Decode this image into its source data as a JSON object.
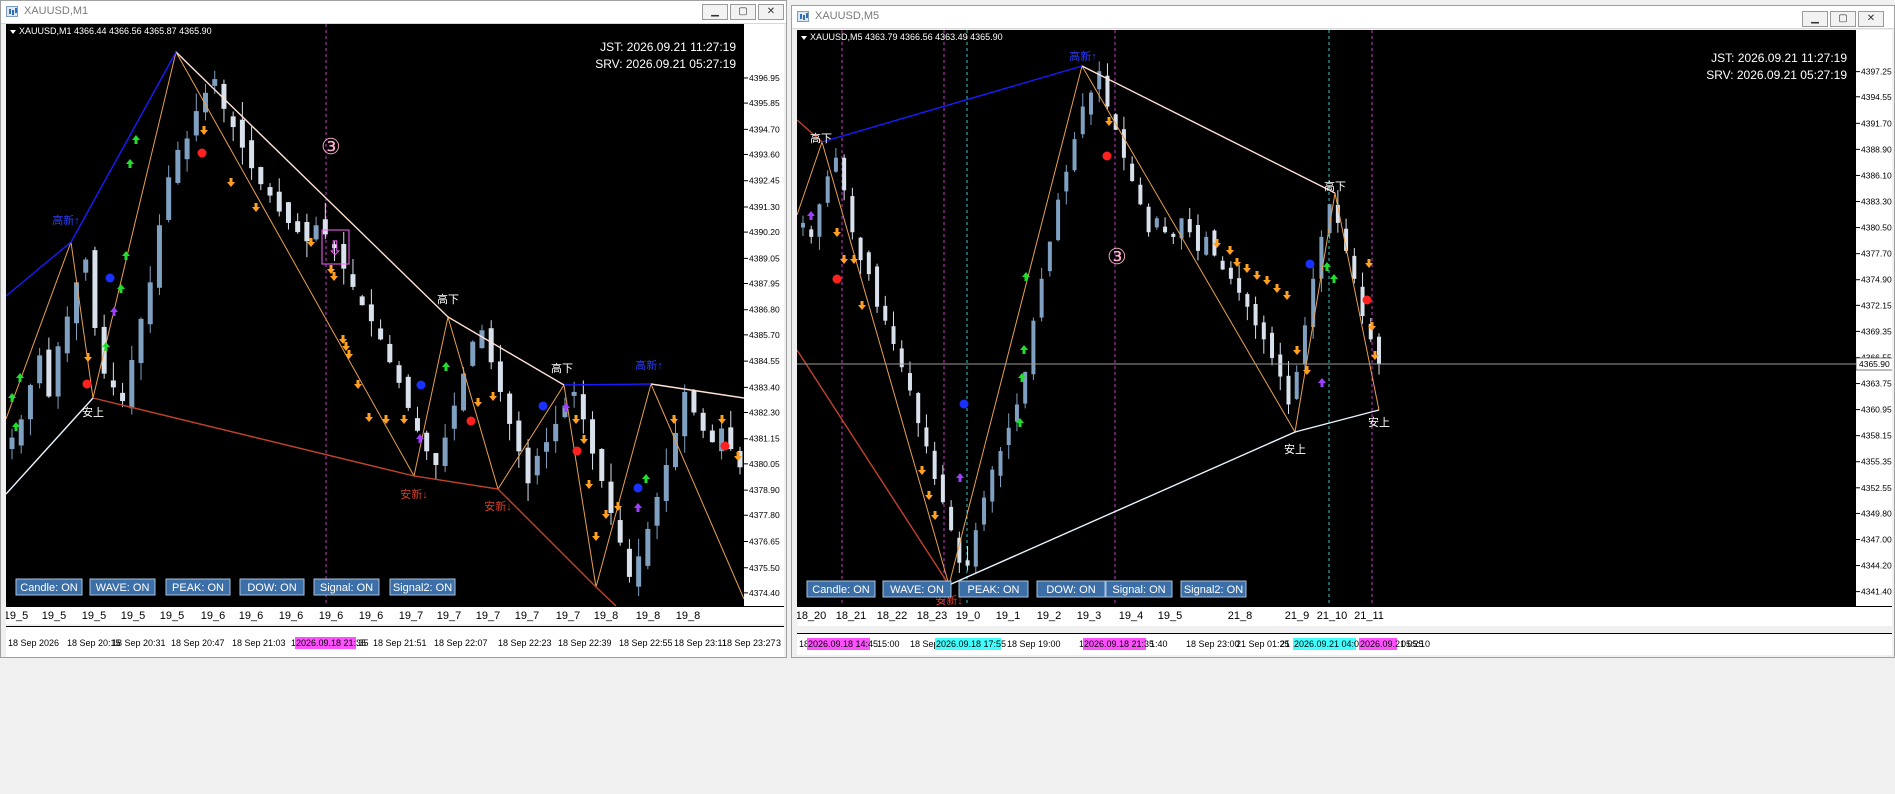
{
  "colors": {
    "bull": "#7fa0c0",
    "bear": "#d9e2ec",
    "zig": "#e8a050",
    "swing_top": "#ffe2d6",
    "swing_blue": "#1a1aff",
    "swing_red": "#c0422c",
    "swing_white": "#e8f4ff",
    "arrow_up": "#20dd30",
    "arrow_down": "#ffa020",
    "arrow_purple": "#a040ff",
    "dot_red": "#ff2020",
    "dot_blue": "#1a30ff",
    "vline_magenta": "#c040c0",
    "vline_cyan": "#40c0c0",
    "button_bg": "#3c6ea8",
    "button_text": "#ffffff",
    "label_jp": "#ffffff",
    "label_blue": "#2a3cff",
    "label_red": "#d2402a",
    "marker": "#ff60ff"
  },
  "left": {
    "window_title": "XAUUSD,M1",
    "header": "XAUUSD,M1  4366.44 4366.56 4365.87 4365.90",
    "jst": "JST: 2026.09.21 11:27:19",
    "srv": "SRV: 2026.09.21 05:27:19",
    "circled": "③",
    "last_price_label": "",
    "buttons": [
      "Candle: ON",
      "WAVE: ON",
      "PEAK: ON",
      "DOW: ON",
      "Signal: ON",
      "Signal2: ON"
    ],
    "wave_labels": [
      "19_5",
      "19_5",
      "19_5",
      "19_5",
      "19_5",
      "19_6",
      "19_6",
      "19_6",
      "19_6",
      "19_6",
      "19_7",
      "19_7",
      "19_7",
      "19_7",
      "19_7",
      "19_8",
      "19_8",
      "19_8"
    ],
    "time_labels": [
      "18 Sep 2026",
      "18 Sep 20:15",
      "18 Sep 20:31",
      "18 Sep 20:47",
      "18 Sep 21:03",
      "18 Se",
      "2026.09.18 21:35",
      ":35",
      "18 Sep 21:51",
      "18 Sep 22:07",
      "18 Sep 22:23",
      "18 Sep 22:39",
      "18 Sep 22:55",
      "18 Sep 23:11",
      "18 Sep 23:27"
    ],
    "jp_labels": [
      "高新↑",
      "安上",
      "高下",
      "安新↓",
      "安新↓",
      "高下",
      "高新↑"
    ],
    "chart_data": {
      "type": "candlestick",
      "symbol": "XAUUSD",
      "timeframe": "M1",
      "price_ticks": [
        4396.95,
        4395.85,
        4394.7,
        4393.6,
        4392.45,
        4391.3,
        4390.2,
        4389.05,
        4387.95,
        4386.8,
        4385.7,
        4384.55,
        4383.4,
        4382.3,
        4381.15,
        4380.05,
        4378.9,
        4377.8,
        4376.65,
        4375.5,
        4374.4
      ],
      "ylim": [
        4374.0,
        4398.0
      ],
      "x_axis_right_label": "3",
      "last_close": 4365.9,
      "note_close_series": "approximate closes, oldest to newest",
      "close": [
        4381.2,
        4382.0,
        4383.5,
        4384.8,
        4383.0,
        4385.2,
        4386.5,
        4388.0,
        4389.0,
        4386.0,
        4384.0,
        4383.4,
        4382.8,
        4384.6,
        4386.4,
        4388.0,
        4390.5,
        4392.6,
        4393.8,
        4394.3,
        4395.5,
        4396.3,
        4396.9,
        4395.6,
        4394.8,
        4393.9,
        4393.0,
        4392.3,
        4391.8,
        4391.1,
        4390.6,
        4390.2,
        4389.8,
        4390.5,
        4390.1,
        4389.5,
        4388.6,
        4387.8,
        4387.0,
        4386.3,
        4385.5,
        4384.5,
        4383.6,
        4382.5,
        4381.5,
        4380.6,
        4380.0,
        4381.2,
        4382.6,
        4384.0,
        4385.4,
        4385.9,
        4384.5,
        4383.2,
        4381.8,
        4380.6,
        4379.2,
        4380.4,
        4381.0,
        4381.8,
        4382.6,
        4383.2,
        4382.0,
        4380.5,
        4379.3,
        4377.9,
        4376.6,
        4375.1,
        4376.0,
        4377.2,
        4378.6,
        4380.0,
        4381.4,
        4383.2,
        4382.3,
        4381.5,
        4381.0,
        4381.6,
        4380.7,
        4379.9
      ]
    }
  },
  "right": {
    "window_title": "XAUUSD,M5",
    "header": "XAUUSD,M5  4363.79 4366.56 4363.49 4365.90",
    "jst": "JST: 2026.09.21 11:27:19",
    "srv": "SRV: 2026.09.21 05:27:19",
    "circled": "③",
    "last_price_label": "4365.90",
    "buttons": [
      "Candle: ON",
      "WAVE: ON",
      "PEAK: ON",
      "DOW: ON",
      "Signal: ON",
      "Signal2: ON"
    ],
    "wave_labels": [
      "18_20",
      "18_21",
      "18_22",
      "18_23",
      "19_0",
      "19_1",
      "19_2",
      "19_3",
      "19_4",
      "19_5",
      "21_8",
      "21_9",
      "21_10",
      "21_11"
    ],
    "time_labels": [
      "18",
      "2026.09.18 14:45",
      "15:00",
      "18 Sep 1",
      "2026.09.18 17:55",
      "18 Sep 19:00",
      "18",
      "2026.09.18 21:35",
      "1:40",
      "18 Sep 23:00",
      "21 Sep 01:25",
      "21 Se",
      "2026.09.21 04:05",
      "2026.09.21 05:10",
      "05:25"
    ],
    "jp_labels": [
      "高下",
      "高新↑",
      "安新↓",
      "高下",
      "安上",
      "安上"
    ],
    "chart_data": {
      "type": "candlestick",
      "symbol": "XAUUSD",
      "timeframe": "M5",
      "price_ticks": [
        4397.25,
        4394.55,
        4391.7,
        4388.9,
        4386.1,
        4383.3,
        4380.5,
        4377.7,
        4374.9,
        4372.15,
        4369.35,
        4366.55,
        4363.75,
        4360.95,
        4358.15,
        4355.35,
        4352.55,
        4349.8,
        4347.0,
        4344.2,
        4341.4
      ],
      "ylim": [
        4340.5,
        4398.5
      ],
      "last_close": 4365.9,
      "note_close_series": "approximate closes, oldest to newest",
      "close": [
        4381.0,
        4379.5,
        4383.0,
        4386.0,
        4388.0,
        4384.5,
        4380.0,
        4377.0,
        4375.5,
        4372.0,
        4370.5,
        4368.0,
        4365.5,
        4363.0,
        4359.5,
        4357.0,
        4353.5,
        4351.0,
        4348.0,
        4344.5,
        4344.2,
        4348.0,
        4351.5,
        4354.5,
        4356.5,
        4359.0,
        4361.5,
        4365.0,
        4370.5,
        4375.0,
        4379.0,
        4383.5,
        4386.5,
        4390.0,
        4393.5,
        4395.0,
        4397.3,
        4393.5,
        4391.0,
        4388.0,
        4385.5,
        4383.0,
        4380.0,
        4381.5,
        4380.0,
        4379.5,
        4381.5,
        4380.0,
        4378.0,
        4379.5,
        4377.5,
        4376.0,
        4375.0,
        4373.5,
        4372.0,
        4370.0,
        4368.5,
        4366.5,
        4364.5,
        4361.5,
        4365.0,
        4370.0,
        4375.0,
        4379.5,
        4383.0,
        4381.0,
        4378.0,
        4375.0,
        4371.0,
        4368.5,
        4365.9
      ]
    }
  }
}
